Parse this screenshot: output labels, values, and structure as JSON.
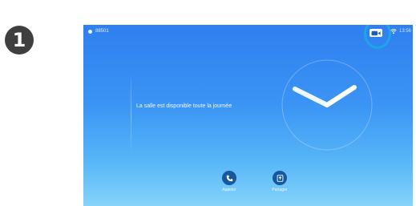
{
  "step": {
    "number": "1"
  },
  "device_screen": {
    "status_bar": {
      "system_name": "88501",
      "time": "13:56",
      "self_view_icon": "camera-selfview-icon",
      "wifi_icon": "wifi-icon"
    },
    "availability_text": "La salle est disponible toute la journée",
    "clock_icon": "analog-clock",
    "actions": [
      {
        "label": "Appeler",
        "icon": "phone-icon"
      },
      {
        "label": "Partager",
        "icon": "share-screen-icon"
      }
    ]
  },
  "colors": {
    "screen_gradient_top": "#2f7ff0",
    "screen_gradient_bottom": "#86d3fb",
    "action_button": "#16589f",
    "highlight_ring": "#1fa6e8",
    "step_badge": "#3f3f3f"
  }
}
